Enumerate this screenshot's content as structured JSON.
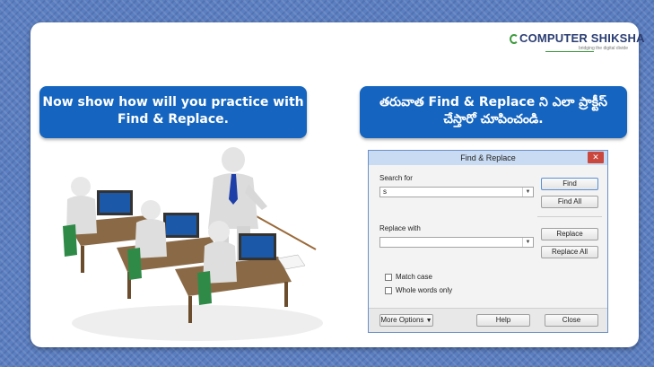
{
  "logo": {
    "text": "COMPUTER SHIKSHA",
    "tagline": "bridging the digital divide"
  },
  "banner_left": {
    "line1": "Now show how will you practice with",
    "line2": "Find & Replace."
  },
  "banner_right": {
    "line1": "తరువాత Find & Replace ని ఎలా ప్రాక్టీస్",
    "line2": "చేస్తారో చూపించండి."
  },
  "dialog": {
    "title": "Find & Replace",
    "close_label": "✕",
    "search_label": "Search for",
    "search_value": "s",
    "replace_label": "Replace with",
    "replace_value": "",
    "find_button": "Find",
    "find_all_button": "Find All",
    "replace_button": "Replace",
    "replace_all_button": "Replace All",
    "match_case": "Match case",
    "whole_words": "Whole words only",
    "more_options": "More Options",
    "help_button": "Help",
    "close_button": "Close"
  },
  "colors": {
    "banner": "#1565c0",
    "background": "#5b7fc0",
    "dialog_title": "#c9dbf2"
  }
}
